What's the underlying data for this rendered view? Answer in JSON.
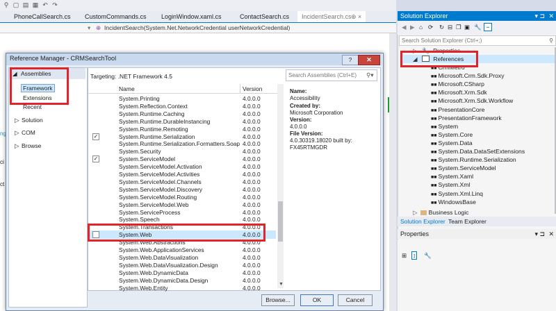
{
  "tabs": [
    "PhoneCallSearch.cs",
    "CustomCommands.cs",
    "LoginWindow.xaml.cs",
    "ContactSearch.cs",
    "IncidentSearch.cs"
  ],
  "tab_pin": "⊕ ×",
  "navbar": {
    "member": "IncidentSearch(System.Net.NetworkCredential userNetworkCredential)"
  },
  "editor_fragments": [
    "ng",
    "ci",
    "ct"
  ],
  "solution_explorer": {
    "title": "Solution Explorer",
    "search_placeholder": "Search Solution Explorer (Ctrl+;)",
    "items": [
      {
        "label": "Properties",
        "kind": "properties"
      },
      {
        "label": "References",
        "kind": "references",
        "selected": true
      },
      {
        "label": "CrmMetro",
        "kind": "ref"
      },
      {
        "label": "Microsoft.Crm.Sdk.Proxy",
        "kind": "ref"
      },
      {
        "label": "Microsoft.CSharp",
        "kind": "ref"
      },
      {
        "label": "Microsoft.Xrm.Sdk",
        "kind": "ref"
      },
      {
        "label": "Microsoft.Xrm.Sdk.Workflow",
        "kind": "ref"
      },
      {
        "label": "PresentationCore",
        "kind": "ref"
      },
      {
        "label": "PresentationFramework",
        "kind": "ref"
      },
      {
        "label": "System",
        "kind": "ref"
      },
      {
        "label": "System.Core",
        "kind": "ref"
      },
      {
        "label": "System.Data",
        "kind": "ref"
      },
      {
        "label": "System.Data.DataSetExtensions",
        "kind": "ref"
      },
      {
        "label": "System.Runtime.Serialization",
        "kind": "ref"
      },
      {
        "label": "System.ServiceModel",
        "kind": "ref"
      },
      {
        "label": "System.Xaml",
        "kind": "ref"
      },
      {
        "label": "System.Xml",
        "kind": "ref"
      },
      {
        "label": "System.Xml.Linq",
        "kind": "ref"
      },
      {
        "label": "WindowsBase",
        "kind": "ref"
      },
      {
        "label": "Business Logic",
        "kind": "folder"
      }
    ],
    "bottom_tabs": [
      "Solution Explorer",
      "Team Explorer"
    ]
  },
  "properties_panel": {
    "title": "Properties"
  },
  "dialog": {
    "title": "Reference Manager - CRMSearchTool",
    "help": "?",
    "close": "✕",
    "nav": {
      "assemblies": "Assemblies",
      "framework": "Framework",
      "extensions": "Extensions",
      "recent": "Recent",
      "solution": "Solution",
      "com": "COM",
      "browse": "Browse"
    },
    "targeting": "Targeting: .NET Framework 4.5",
    "search_placeholder": "Search Assemblies (Ctrl+E)",
    "col_name": "Name",
    "col_version": "Version",
    "assemblies": [
      {
        "name": "System.Printing",
        "version": "4.0.0.0",
        "checked": false
      },
      {
        "name": "System.Reflection.Context",
        "version": "4.0.0.0",
        "checked": false
      },
      {
        "name": "System.Runtime.Caching",
        "version": "4.0.0.0",
        "checked": false
      },
      {
        "name": "System.Runtime.DurableInstancing",
        "version": "4.0.0.0",
        "checked": false
      },
      {
        "name": "System.Runtime.Remoting",
        "version": "4.0.0.0",
        "checked": false
      },
      {
        "name": "System.Runtime.Serialization",
        "version": "4.0.0.0",
        "checked": true
      },
      {
        "name": "System.Runtime.Serialization.Formatters.Soap",
        "version": "4.0.0.0",
        "checked": false
      },
      {
        "name": "System.Security",
        "version": "4.0.0.0",
        "checked": false
      },
      {
        "name": "System.ServiceModel",
        "version": "4.0.0.0",
        "checked": true
      },
      {
        "name": "System.ServiceModel.Activation",
        "version": "4.0.0.0",
        "checked": false
      },
      {
        "name": "System.ServiceModel.Activities",
        "version": "4.0.0.0",
        "checked": false
      },
      {
        "name": "System.ServiceModel.Channels",
        "version": "4.0.0.0",
        "checked": false
      },
      {
        "name": "System.ServiceModel.Discovery",
        "version": "4.0.0.0",
        "checked": false
      },
      {
        "name": "System.ServiceModel.Routing",
        "version": "4.0.0.0",
        "checked": false
      },
      {
        "name": "System.ServiceModel.Web",
        "version": "4.0.0.0",
        "checked": false
      },
      {
        "name": "System.ServiceProcess",
        "version": "4.0.0.0",
        "checked": false
      },
      {
        "name": "System.Speech",
        "version": "4.0.0.0",
        "checked": false
      },
      {
        "name": "System.Transactions",
        "version": "4.0.0.0",
        "checked": false
      },
      {
        "name": "System.Web",
        "version": "4.0.0.0",
        "checked": false,
        "highlight": true
      },
      {
        "name": "System.Web.Abstractions",
        "version": "4.0.0.0",
        "checked": false
      },
      {
        "name": "System.Web.ApplicationServices",
        "version": "4.0.0.0",
        "checked": false
      },
      {
        "name": "System.Web.DataVisualization",
        "version": "4.0.0.0",
        "checked": false
      },
      {
        "name": "System.Web.DataVisualization.Design",
        "version": "4.0.0.0",
        "checked": false
      },
      {
        "name": "System.Web.DynamicData",
        "version": "4.0.0.0",
        "checked": false
      },
      {
        "name": "System.Web.DynamicData.Design",
        "version": "4.0.0.0",
        "checked": false
      },
      {
        "name": "System.Web.Entity",
        "version": "4.0.0.0",
        "checked": false
      }
    ],
    "details": {
      "name_label": "Name:",
      "name_value": "Accessibility",
      "created_label": "Created by:",
      "created_value": "Microsoft Corporation",
      "version_label": "Version:",
      "version_value": "4.0.0.0",
      "file_version_label": "File Version:",
      "file_version_value": "4.0.30319.18020 built by:",
      "file_version_value2": "FX45RTMGDR"
    },
    "buttons": {
      "browse": "Browse...",
      "ok": "OK",
      "cancel": "Cancel"
    }
  },
  "colors": {
    "accent": "#007acc",
    "highlight_box": "#e0242a",
    "selection": "#cce8ff"
  }
}
